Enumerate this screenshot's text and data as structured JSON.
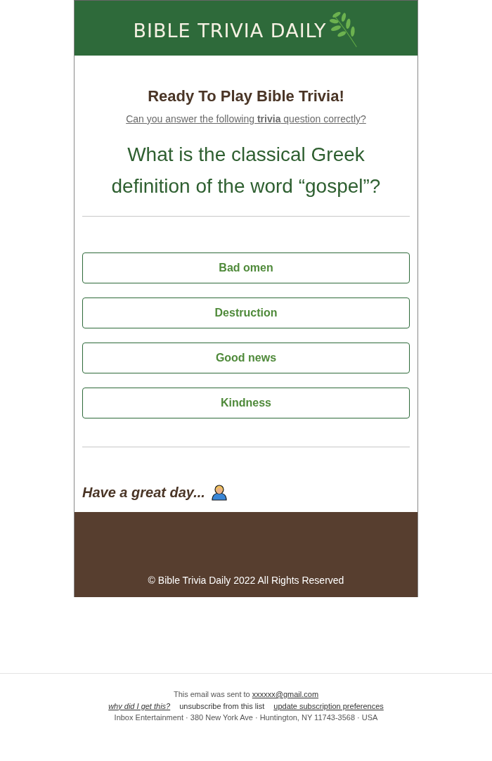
{
  "header": {
    "logo": "BIBLE TRIVIA DAILY"
  },
  "intro": {
    "title": "Ready To Play Bible Trivia!",
    "subtitle": "Can you answer the following **trivia** question correctly?"
  },
  "question": "What is the classical Greek definition of the word “gospel”?",
  "answers": [
    "Bad omen",
    "Destruction",
    "Good news",
    "Kindness"
  ],
  "signoff": "Have a great day...",
  "footer": {
    "copyright": "© Bible Trivia Daily 2022 All Rights Reserved"
  },
  "email_footer": {
    "sent_to_prefix": "This email was sent to",
    "email": "xxxxxx@gmail.com",
    "links": [
      {
        "label": "why did I get this?",
        "kind": "italic"
      },
      {
        "label": "unsubscribe from this list",
        "kind": "plain"
      },
      {
        "label": "update subscription preferences",
        "kind": "underlined"
      }
    ],
    "address": "Inbox Entertainment · 380 New York Ave · Huntington, NY 11743-3568 · USA"
  }
}
